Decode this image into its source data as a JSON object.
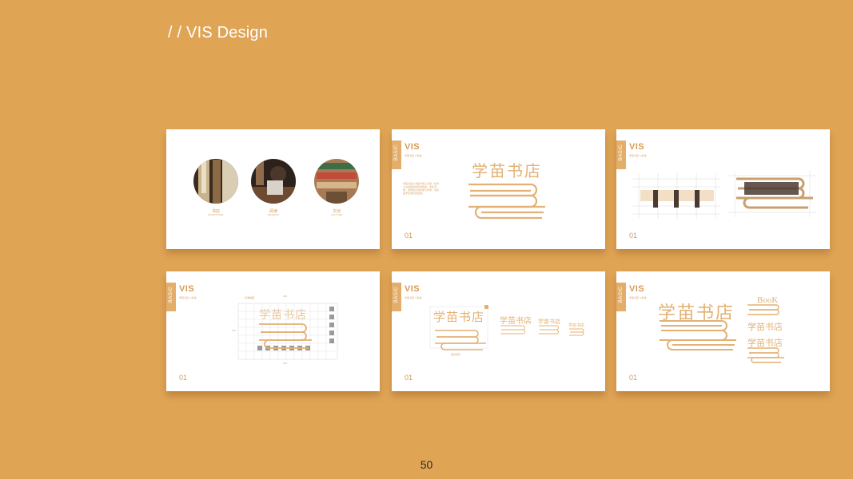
{
  "header": {
    "title": "/ / VIS Design"
  },
  "page": {
    "number": "50"
  },
  "slide_common": {
    "tab_label": "BASIC",
    "vis_label": "VIS",
    "vis_sub": "学苗书店 VI系统",
    "slide_number": "01"
  },
  "slide1": {
    "photos": [
      {
        "label": "书店",
        "sub": "BOOKSTORE"
      },
      {
        "label": "阅读",
        "sub": "READING"
      },
      {
        "label": "文创",
        "sub": "CULTURE"
      }
    ]
  },
  "slide2": {
    "logo_text": "学苗书店",
    "body": "学苗书店以书籍为核心元素，标志以书本层叠的形态构成，线条流畅，寓意知识的积累与传承，书店是学生成长的园地。"
  },
  "slide4": {
    "dim_top": "220",
    "dim_left": "150",
    "dim_bottom": "160",
    "grid_note": "标准制图"
  },
  "slide5": {
    "logo_text": "学苗书店",
    "caption": "组合规范"
  },
  "slide6": {
    "logo_text": "学苗书店",
    "book_word": "BooK"
  },
  "colors": {
    "background": "#E0A455",
    "accent": "#D79B55",
    "tab": "#E3AD6A",
    "card": "#ffffff"
  }
}
